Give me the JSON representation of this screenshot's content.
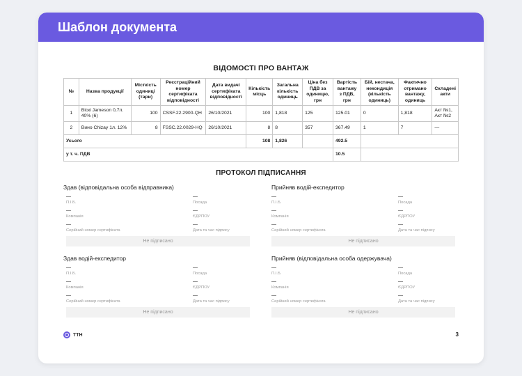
{
  "header": {
    "title": "Шаблон документа"
  },
  "document": {
    "title": "ВІДОМОСТІ ПРО ВАНТАЖ"
  },
  "cargo_table": {
    "headers": [
      "№",
      "Назва продукції",
      "Місткість одиниці (тари)",
      "Реєстраційний номер сертифіката відповідності",
      "Дата видачі сертифіката відповідності",
      "Кількість місць",
      "Загальна кількість одиниць",
      "Ціна без ПДВ за одиницю, грн",
      "Вартість вантажу з ПДВ, грн",
      "Бій, нестача, некондиція (кількість одиниць)",
      "Фактично отримано вантажу, одиниць",
      "Складені акти"
    ],
    "rows": [
      [
        "1",
        "Віскі Jameson 0,7л. 40% (6)",
        "100",
        "CSSF.22.2900-QH",
        "26/10/2021",
        "100",
        "1,818",
        "125",
        "125.01",
        "0",
        "1,818",
        "Акт №1, Акт №2"
      ],
      [
        "2",
        "Вино Chizay 1л. 12%",
        "8",
        "FSSC.22.0029-HQ",
        "26/10/2021",
        "8",
        "8",
        "357",
        "367.49",
        "1",
        "7",
        "—"
      ]
    ],
    "total": {
      "label": "Усього",
      "places": "108",
      "units": "1,826",
      "value": "492.5"
    },
    "vat": {
      "label": "у т. ч. ПДВ",
      "value": "10.5"
    }
  },
  "protocol": {
    "title": "ПРОТОКОЛ ПІДПИСАННЯ",
    "blocks": [
      {
        "title": "Здав (відповідальна особа відправника)",
        "name": "—",
        "name_label": "П.І.Б.",
        "position": "—",
        "position_label": "Посада",
        "company": "—",
        "company_label": "Компанія",
        "edrpou": "—",
        "edrpou_label": "ЄДРПОУ",
        "cert": "—",
        "cert_label": "Серійний номер сертифіката",
        "datetime": "—",
        "datetime_label": "Дата та час підпису",
        "status": "Не підписано"
      },
      {
        "title": "Прийняв водій-експедитор",
        "name": "—",
        "name_label": "П.І.Б.",
        "position": "—",
        "position_label": "Посада",
        "company": "—",
        "company_label": "Компанія",
        "edrpou": "—",
        "edrpou_label": "ЄДРПОУ",
        "cert": "—",
        "cert_label": "Серійний номер сертифіката",
        "datetime": "—",
        "datetime_label": "Дата та час підпису",
        "status": "Не підписано"
      },
      {
        "title": "Здав водій-експедитор",
        "name": "—",
        "name_label": "П.І.Б.",
        "position": "—",
        "position_label": "Посада",
        "company": "—",
        "company_label": "Компанія",
        "edrpou": "—",
        "edrpou_label": "ЄДРПОУ",
        "cert": "—",
        "cert_label": "Серійний номер сертифіката",
        "datetime": "—",
        "datetime_label": "Дата та час підпису",
        "status": "Не підписано"
      },
      {
        "title": "Прийняв (відповідальна особа одержувача)",
        "name": "—",
        "name_label": "П.І.Б.",
        "position": "—",
        "position_label": "Посада",
        "company": "—",
        "company_label": "Компанія",
        "edrpou": "—",
        "edrpou_label": "ЄДРПОУ",
        "cert": "—",
        "cert_label": "Серійний номер сертифіката",
        "datetime": "—",
        "datetime_label": "Дата та час підпису",
        "status": "Не підписано"
      }
    ]
  },
  "footer": {
    "logo_text": "ТТН",
    "logo_icon": "ttn-logo-icon",
    "page": "3"
  },
  "colors": {
    "accent": "#6a5ae0"
  }
}
